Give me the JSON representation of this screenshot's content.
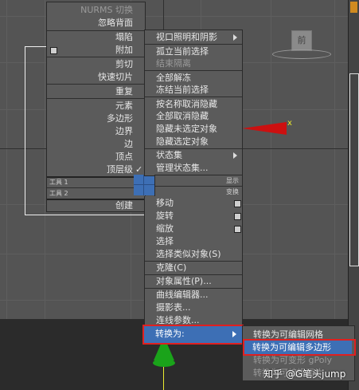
{
  "viewport": {
    "axis_label": "x",
    "cube_label": "前"
  },
  "quad_top_left": {
    "items": [
      "NURMS 切换",
      "忽略背面",
      "塌陷",
      "附加",
      "剪切",
      "快速切片",
      "重复",
      "元素",
      "多边形",
      "边界",
      "边",
      "顶点",
      "顶层级"
    ],
    "check": "✓",
    "tools1_left": "工具 1",
    "tools1_right": "显示",
    "tools2_left": "工具 2",
    "tools2_right": "变换",
    "create": "创建"
  },
  "quad_top_right": {
    "items": [
      "视口照明和阴影",
      "孤立当前选择",
      "结束隔离",
      "全部解冻",
      "冻结当前选择",
      "按名称取消隐藏",
      "全部取消隐藏",
      "隐藏未选定对象",
      "隐藏选定对象",
      "状态集",
      "管理状态集..."
    ]
  },
  "quad_bottom_right": {
    "items": [
      "移动",
      "旋转",
      "缩放",
      "选择",
      "选择类似对象(S)",
      "克隆(C)",
      "对象属性(P)...",
      "曲线编辑器...",
      "摄影表...",
      "连线参数...",
      "转换为:"
    ]
  },
  "submenu": {
    "items": [
      "转换为可编辑网格",
      "转换为可编辑多边形",
      "转换为可变形 gPoly",
      "转换为可编辑面片"
    ]
  },
  "watermark": "知乎 @G笔头jump",
  "colors": {
    "highlight": "#3d6fb5",
    "annotation_frame": "#e02020",
    "gizmo_green": "#1aa31a",
    "gizmo_red": "#cc1010"
  }
}
